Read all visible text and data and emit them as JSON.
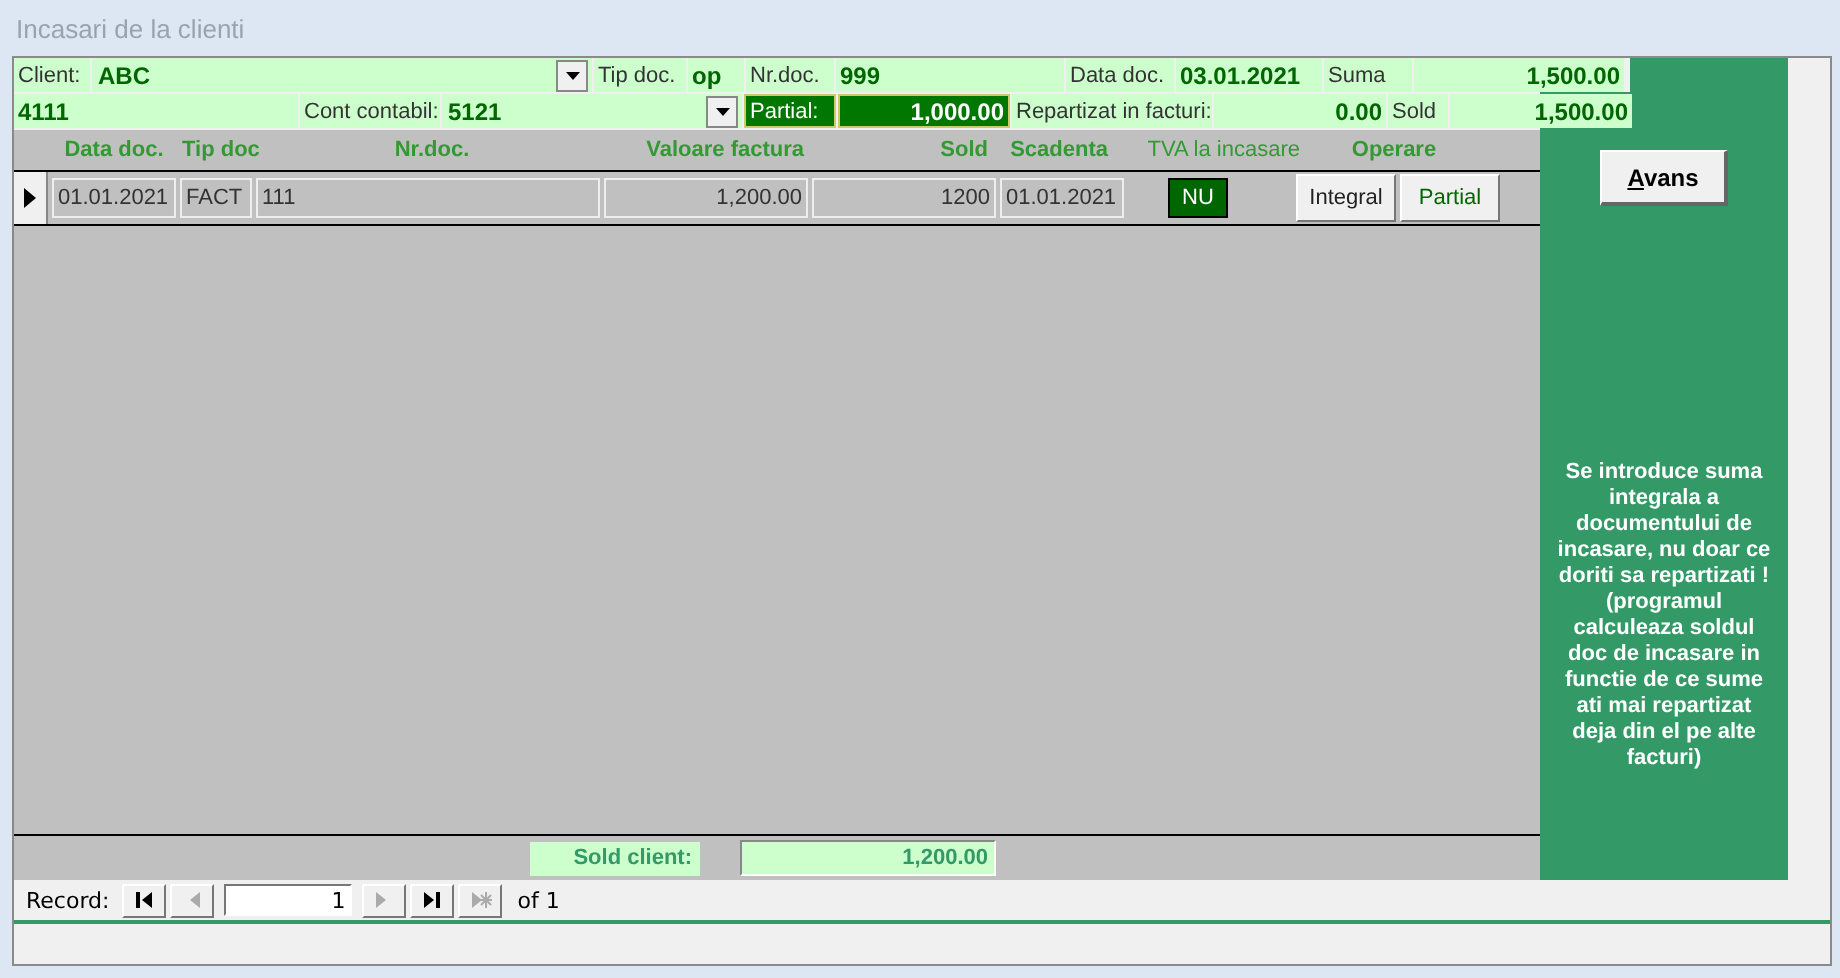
{
  "window": {
    "title": "Incasari de la clienti"
  },
  "header": {
    "client": {
      "label": "Client:",
      "value": "ABC"
    },
    "tip_doc": {
      "label": "Tip doc.",
      "value": "op"
    },
    "nr_doc": {
      "label": "Nr.doc.",
      "value": "999"
    },
    "data_doc": {
      "label": "Data doc.",
      "value": "03.01.2021"
    },
    "suma": {
      "label": "Suma",
      "value": "1,500.00"
    },
    "account": "4111",
    "cont_contabil": {
      "label": "Cont contabil:",
      "value": "5121"
    },
    "partial": {
      "label": "Partial:",
      "value": "1,000.00"
    },
    "repartizat": {
      "label": "Repartizat in facturi:",
      "value": "0.00"
    },
    "sold": {
      "label": "Sold",
      "value": "1,500.00"
    }
  },
  "table": {
    "columns": [
      "Data doc.",
      "Tip doc",
      "Nr.doc.",
      "Valoare factura",
      "Sold",
      "Scadenta",
      "TVA la incasare",
      "Operare"
    ],
    "rows": [
      {
        "selected": true,
        "data_doc": "01.01.2021",
        "tip_doc": "FACT",
        "nr_doc": "111",
        "valoare": "1,200.00",
        "sold": "1200",
        "scadenta": "01.01.2021",
        "tva": "NU",
        "buttons": [
          "Integral",
          "Partial"
        ]
      }
    ]
  },
  "footer": {
    "label": "Sold client:",
    "value": "1,200.00"
  },
  "navigation": {
    "label": "Record:",
    "current": "1",
    "of_label": "of",
    "total": "1"
  },
  "side_panel": {
    "button": "Avans",
    "note": "Se introduce suma integrala a documentului de incasare, nu doar ce doriti sa repartizati ! (programul calculeaza soldul doc de incasare in functie de ce sume ati  mai repartizat deja din el  pe alte facturi)"
  }
}
